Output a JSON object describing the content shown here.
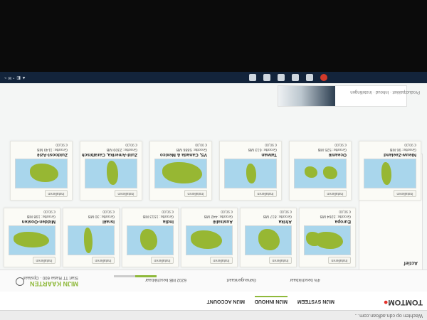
{
  "browser": {
    "status_text": "Wachten op cdn.adfoan.com…"
  },
  "nav": {
    "logo": "TOMTOM",
    "items": [
      "MIJN SYSTEEM",
      "MIJN INHOUD",
      "MIJN ACCOUNT"
    ]
  },
  "device": {
    "title": "MIJN KAARTEN",
    "info": "Start TT Raise 600 · Opslaan",
    "stats": [
      "6202 MB beschikbaar",
      "Geheugenkaart",
      "4% beschikbaar"
    ]
  },
  "left_rail": {
    "title": "Actief"
  },
  "cards": [
    {
      "name": "Europa",
      "size": "Grootte: 3264 MB",
      "price": "€ 90,00",
      "button": "Installeren"
    },
    {
      "name": "Afrika",
      "size": "Grootte: 817 MB",
      "price": "€ 90,00",
      "button": "Installeren"
    },
    {
      "name": "Australië",
      "size": "Grootte: 442 MB",
      "price": "€ 90,00",
      "button": "Installeren"
    },
    {
      "name": "India",
      "size": "Grootte: 1513 MB",
      "price": "€ 90,00",
      "button": "Installeren"
    },
    {
      "name": "Israël",
      "size": "Grootte: 30 MB",
      "price": "€ 90,00",
      "button": "Installeren"
    },
    {
      "name": "Midden-Oosten",
      "size": "Grootte: 198 MB",
      "price": "€ 90,00",
      "button": "Installeren"
    },
    {
      "name": "Nieuw-Zeeland",
      "size": "Grootte: 96 MB",
      "price": "€ 90,00",
      "button": "Installeren"
    },
    {
      "name": "Oceanië",
      "size": "Grootte: 525 MB",
      "price": "€ 90,00",
      "button": "Installeren"
    },
    {
      "name": "Taiwan",
      "size": "Grootte: 613 MB",
      "price": "€ 90,00",
      "button": "Installeren"
    },
    {
      "name": "VS, Canada & Mexico",
      "size": "Grootte: 5886 MB",
      "price": "€ 90,00",
      "button": "Installeren"
    },
    {
      "name": "Zuid-Amerika, Caraïbisch",
      "size": "Grootte: 2309 MB",
      "price": "€ 90,00",
      "button": "Installeren"
    },
    {
      "name": "Zuidoost-Azië",
      "size": "Grootte: 1149 MB",
      "price": "€ 90,00",
      "button": "Installeren"
    }
  ],
  "breadcrumb": "Productpakket · Inhoud · Instellingen",
  "taskbar": {
    "icons": [
      "chrome-icon",
      "app-icon",
      "app-icon",
      "app-icon",
      "app-icon",
      "app-icon"
    ]
  },
  "colors": {
    "accent": "#8fb93b",
    "map_water": "#a9d6ec",
    "map_land": "#97b733",
    "taskbar": "#13243b"
  }
}
